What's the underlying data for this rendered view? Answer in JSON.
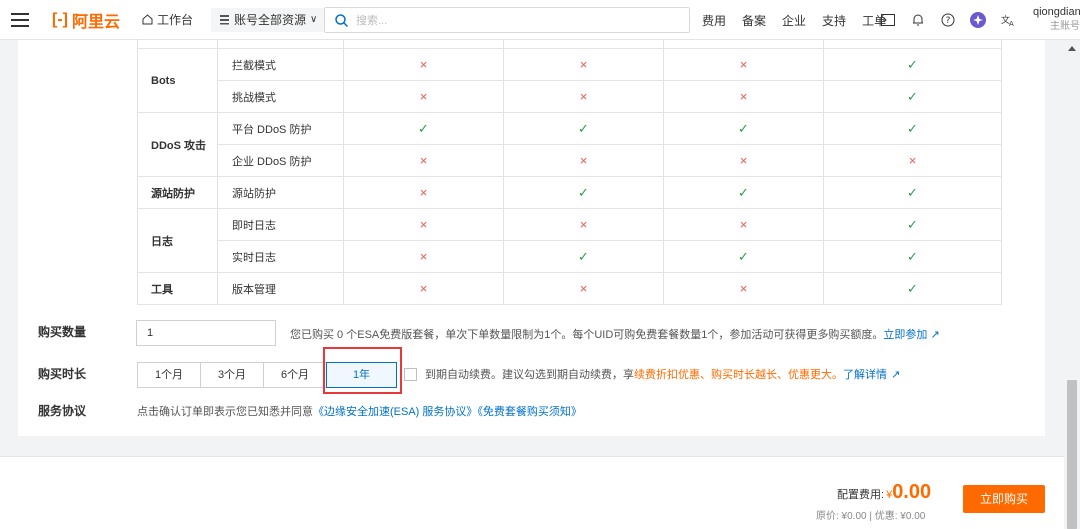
{
  "topbar": {
    "logo_text": "阿里云",
    "workbench": "工作台",
    "resources": "账号全部资源",
    "search_placeholder": "搜索...",
    "links": [
      "费用",
      "备案",
      "企业",
      "支持",
      "工单"
    ],
    "user_name": "qiongdian",
    "user_role": "主账号"
  },
  "table": {
    "rows": [
      {
        "cat": "",
        "sub": "",
        "marks": [
          "",
          "",
          "",
          ""
        ]
      },
      {
        "cat": "Bots",
        "sub": "拦截模式",
        "marks": [
          "cross",
          "cross",
          "cross",
          "check"
        ]
      },
      {
        "cat": "",
        "sub": "挑战模式",
        "marks": [
          "cross",
          "cross",
          "cross",
          "check"
        ]
      },
      {
        "cat": "DDoS 攻击",
        "sub": "平台 DDoS 防护",
        "marks": [
          "check",
          "check",
          "check",
          "check"
        ]
      },
      {
        "cat": "",
        "sub": "企业 DDoS 防护",
        "marks": [
          "cross",
          "cross",
          "cross",
          "cross"
        ]
      },
      {
        "cat": "源站防护",
        "sub": "源站防护",
        "marks": [
          "cross",
          "check",
          "check",
          "check"
        ]
      },
      {
        "cat": "日志",
        "sub": "即时日志",
        "marks": [
          "cross",
          "cross",
          "cross",
          "check"
        ]
      },
      {
        "cat": "",
        "sub": "实时日志",
        "marks": [
          "cross",
          "check",
          "check",
          "check"
        ]
      },
      {
        "cat": "工具",
        "sub": "版本管理",
        "marks": [
          "cross",
          "cross",
          "cross",
          "check"
        ]
      }
    ],
    "cross_glyph": "×",
    "check_glyph": "✓"
  },
  "form": {
    "qty_label": "购买数量",
    "qty_value": "1",
    "qty_note": "您已购买 0 个ESA免费版套餐，单次下单数量限制为1个。每个UID可购免费套餐数量1个，参加活动可获得更多购买额度。",
    "qty_link": "立即参加",
    "duration_label": "购买时长",
    "durations": [
      "1个月",
      "3个月",
      "6个月",
      "1年"
    ],
    "duration_selected": "1年",
    "auto_renew_text": "到期自动续费。建议勾选到期自动续费，享",
    "auto_renew_orange": "续费折扣优惠、购买时长越长、优惠更大。",
    "auto_renew_link": "了解详情",
    "agreement_label": "服务协议",
    "agreement_text": "点击确认订单即表示您已知悉并同意",
    "agreement_link1": "《边缘安全加速(ESA) 服务协议》",
    "agreement_link2": "《免费套餐购买须知》"
  },
  "footer": {
    "price_label": "配置费用:",
    "currency": "¥",
    "price": "0.00",
    "original": "原价: ¥0.00 | 优惠: ¥0.00",
    "buy_label": "立即购买"
  },
  "colors": {
    "accent": "#ff6a00",
    "link": "#0070cc",
    "cross": "#e55b4c",
    "check": "#27a048",
    "highlight": "#e5393a"
  }
}
